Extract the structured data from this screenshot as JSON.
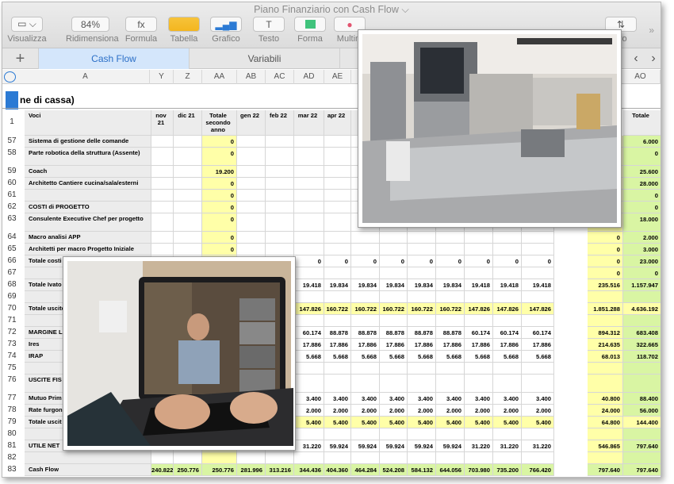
{
  "window_title": "Piano Finanziario con Cash Flow",
  "toolbar": [
    {
      "label": "Visualizza",
      "icon": "sidebar-icon",
      "value": ""
    },
    {
      "label": "Ridimensiona",
      "icon": "zoom-field",
      "value": "84%"
    },
    {
      "label": "Formula",
      "icon": "function-icon",
      "value": "fx"
    },
    {
      "label": "Tabella",
      "icon": "table-icon",
      "value": ""
    },
    {
      "label": "Grafico",
      "icon": "chart-icon",
      "value": ""
    },
    {
      "label": "Testo",
      "icon": "text-icon",
      "value": "T"
    },
    {
      "label": "Forma",
      "icon": "shape-icon",
      "value": ""
    },
    {
      "label": "Multim",
      "icon": "media-icon",
      "value": ""
    },
    {
      "label": "ltro",
      "icon": "sort-icon",
      "value": ""
    }
  ],
  "tabs": [
    "Cash Flow",
    "Variabili"
  ],
  "column_headers": [
    "A",
    "Y",
    "Z",
    "AA",
    "AB",
    "AC",
    "AD",
    "AE",
    "AO"
  ],
  "sheet_title": "ne di cassa)",
  "header_row": {
    "num": "1",
    "voci": "Voci",
    "months": [
      "nov 21",
      "dic 21",
      "Totale secondo anno",
      "gen 22",
      "feb 22",
      "mar 22",
      "apr 22",
      "m"
    ],
    "total": "Totale"
  },
  "rows": [
    {
      "num": "57",
      "label": "Sistema di gestione delle comande",
      "vals": [
        "",
        "",
        "0",
        "",
        "",
        "",
        "",
        "",
        "",
        "",
        "",
        "",
        "",
        "",
        "0",
        "6.000"
      ]
    },
    {
      "num": "58",
      "label": "Parte robotica della struttura (Assente)",
      "vals": [
        "",
        "",
        "0",
        "",
        "",
        "",
        "",
        "",
        "",
        "",
        "",
        "",
        "",
        "",
        "0",
        "0"
      ]
    },
    {
      "num": "59",
      "label": "Coach",
      "vals": [
        "",
        "",
        "19.200",
        "",
        "",
        "",
        "",
        "",
        "",
        "",
        "",
        "",
        "",
        "",
        "0",
        "25.600"
      ]
    },
    {
      "num": "60",
      "label": "Architetto Cantiere cucina/sala/esterni",
      "vals": [
        "",
        "",
        "0",
        "",
        "",
        "",
        "",
        "",
        "",
        "",
        "",
        "",
        "",
        "",
        "0",
        "28.000"
      ]
    },
    {
      "num": "61",
      "label": "",
      "vals": [
        "",
        "",
        "0",
        "",
        "",
        "",
        "",
        "",
        "",
        "",
        "",
        "",
        "",
        "",
        "0",
        "0"
      ]
    },
    {
      "num": "62",
      "label": "COSTI di PROGETTO",
      "vals": [
        "",
        "",
        "0",
        "",
        "",
        "",
        "",
        "",
        "",
        "",
        "",
        "",
        "",
        "",
        "0",
        "0"
      ]
    },
    {
      "num": "63",
      "label": "Consulente Executive Chef per progetto",
      "vals": [
        "",
        "",
        "0",
        "",
        "",
        "",
        "",
        "",
        "",
        "",
        "",
        "",
        "",
        "",
        "0",
        "18.000"
      ]
    },
    {
      "num": "64",
      "label": "Macro analisi APP",
      "vals": [
        "",
        "",
        "0",
        "",
        "",
        "",
        "",
        "",
        "",
        "",
        "",
        "",
        "",
        "",
        "0",
        "2.000"
      ]
    },
    {
      "num": "65",
      "label": "Architetti per macro Progetto Iniziale",
      "vals": [
        "",
        "",
        "0",
        "",
        "",
        "",
        "",
        "",
        "",
        "",
        "",
        "",
        "",
        "",
        "0",
        "3.000"
      ]
    },
    {
      "num": "66",
      "label": "Totale costi",
      "vals": [
        "",
        "",
        "0",
        "",
        "",
        "0",
        "0",
        "0",
        "0",
        "0",
        "0",
        "0",
        "0",
        "0",
        "0",
        "23.000"
      ]
    },
    {
      "num": "67",
      "label": "",
      "vals": [
        "",
        "",
        "",
        "",
        "",
        "",
        "",
        "",
        "",
        "",
        "",
        "",
        "",
        "",
        "0",
        "0"
      ]
    },
    {
      "num": "68",
      "label": "Totale Ivato",
      "vals": [
        "",
        "",
        "",
        "",
        "",
        "19.418",
        "19.834",
        "19.834",
        "19.834",
        "19.834",
        "19.834",
        "19.418",
        "19.418",
        "19.418",
        "235.516",
        "1.157.947"
      ]
    },
    {
      "num": "69",
      "label": "",
      "vals": [
        "",
        "",
        "",
        "",
        "",
        "",
        "",
        "",
        "",
        "",
        "",
        "",
        "",
        "",
        "",
        ""
      ]
    },
    {
      "num": "70",
      "label": "Totale uscite",
      "vals": [
        "",
        "",
        "",
        "",
        "",
        "147.826",
        "160.722",
        "160.722",
        "160.722",
        "160.722",
        "160.722",
        "147.826",
        "147.826",
        "147.826",
        "1.851.288",
        "4.636.192"
      ]
    },
    {
      "num": "71",
      "label": "",
      "vals": [
        "",
        "",
        "",
        "",
        "",
        "",
        "",
        "",
        "",
        "",
        "",
        "",
        "",
        "",
        "",
        ""
      ]
    },
    {
      "num": "72",
      "label": "MARGINE L",
      "vals": [
        "",
        "",
        "",
        "",
        "",
        "60.174",
        "88.878",
        "88.878",
        "88.878",
        "88.878",
        "88.878",
        "60.174",
        "60.174",
        "60.174",
        "894.312",
        "683.408"
      ]
    },
    {
      "num": "73",
      "label": "Ires",
      "vals": [
        "",
        "",
        "",
        "",
        "",
        "17.886",
        "17.886",
        "17.886",
        "17.886",
        "17.886",
        "17.886",
        "17.886",
        "17.886",
        "17.886",
        "214.635",
        "322.665"
      ]
    },
    {
      "num": "74",
      "label": "IRAP",
      "vals": [
        "",
        "",
        "",
        "",
        "",
        "5.668",
        "5.668",
        "5.668",
        "5.668",
        "5.668",
        "5.668",
        "5.668",
        "5.668",
        "5.668",
        "68.013",
        "118.702"
      ]
    },
    {
      "num": "75",
      "label": "",
      "vals": [
        "",
        "",
        "",
        "",
        "",
        "",
        "",
        "",
        "",
        "",
        "",
        "",
        "",
        "",
        "",
        ""
      ]
    },
    {
      "num": "76",
      "label": "USCITE FIS DETRAIBIL",
      "vals": [
        "",
        "",
        "",
        "",
        "",
        "",
        "",
        "",
        "",
        "",
        "",
        "",
        "",
        "",
        "",
        ""
      ]
    },
    {
      "num": "77",
      "label": "Mutuo Prim",
      "vals": [
        "",
        "",
        "",
        "",
        "",
        "3.400",
        "3.400",
        "3.400",
        "3.400",
        "3.400",
        "3.400",
        "3.400",
        "3.400",
        "3.400",
        "40.800",
        "88.400"
      ]
    },
    {
      "num": "78",
      "label": "Rate furgon",
      "vals": [
        "",
        "",
        "",
        "",
        "",
        "2.000",
        "2.000",
        "2.000",
        "2.000",
        "2.000",
        "2.000",
        "2.000",
        "2.000",
        "2.000",
        "24.000",
        "56.000"
      ]
    },
    {
      "num": "79",
      "label": "Totale uscit",
      "vals": [
        "",
        "",
        "",
        "",
        "",
        "5.400",
        "5.400",
        "5.400",
        "5.400",
        "5.400",
        "5.400",
        "5.400",
        "5.400",
        "5.400",
        "64.800",
        "144.400"
      ]
    },
    {
      "num": "80",
      "label": "",
      "vals": [
        "",
        "",
        "",
        "",
        "",
        "",
        "",
        "",
        "",
        "",
        "",
        "",
        "",
        "",
        "",
        ""
      ]
    },
    {
      "num": "81",
      "label": "UTILE NET",
      "vals": [
        "",
        "",
        "",
        "",
        "",
        "31.220",
        "59.924",
        "59.924",
        "59.924",
        "59.924",
        "59.924",
        "31.220",
        "31.220",
        "31.220",
        "546.865",
        "797.640"
      ]
    },
    {
      "num": "82",
      "label": "",
      "vals": [
        "",
        "",
        "",
        "",
        "",
        "",
        "",
        "",
        "",
        "",
        "",
        "",
        "",
        "",
        "",
        ""
      ]
    },
    {
      "num": "83",
      "label": "Cash Flow",
      "vals": [
        "240.822",
        "250.776",
        "250.776",
        "281.996",
        "313.216",
        "344.436",
        "404.360",
        "464.284",
        "524.208",
        "584.132",
        "644.056",
        "703.980",
        "735.200",
        "766.420",
        "797.640",
        "797.640"
      ]
    }
  ],
  "colors": {
    "accent": "#2b7ad4",
    "yellow": "#ffffa8",
    "green": "#d9f5a3",
    "label_bg": "#ececec"
  }
}
